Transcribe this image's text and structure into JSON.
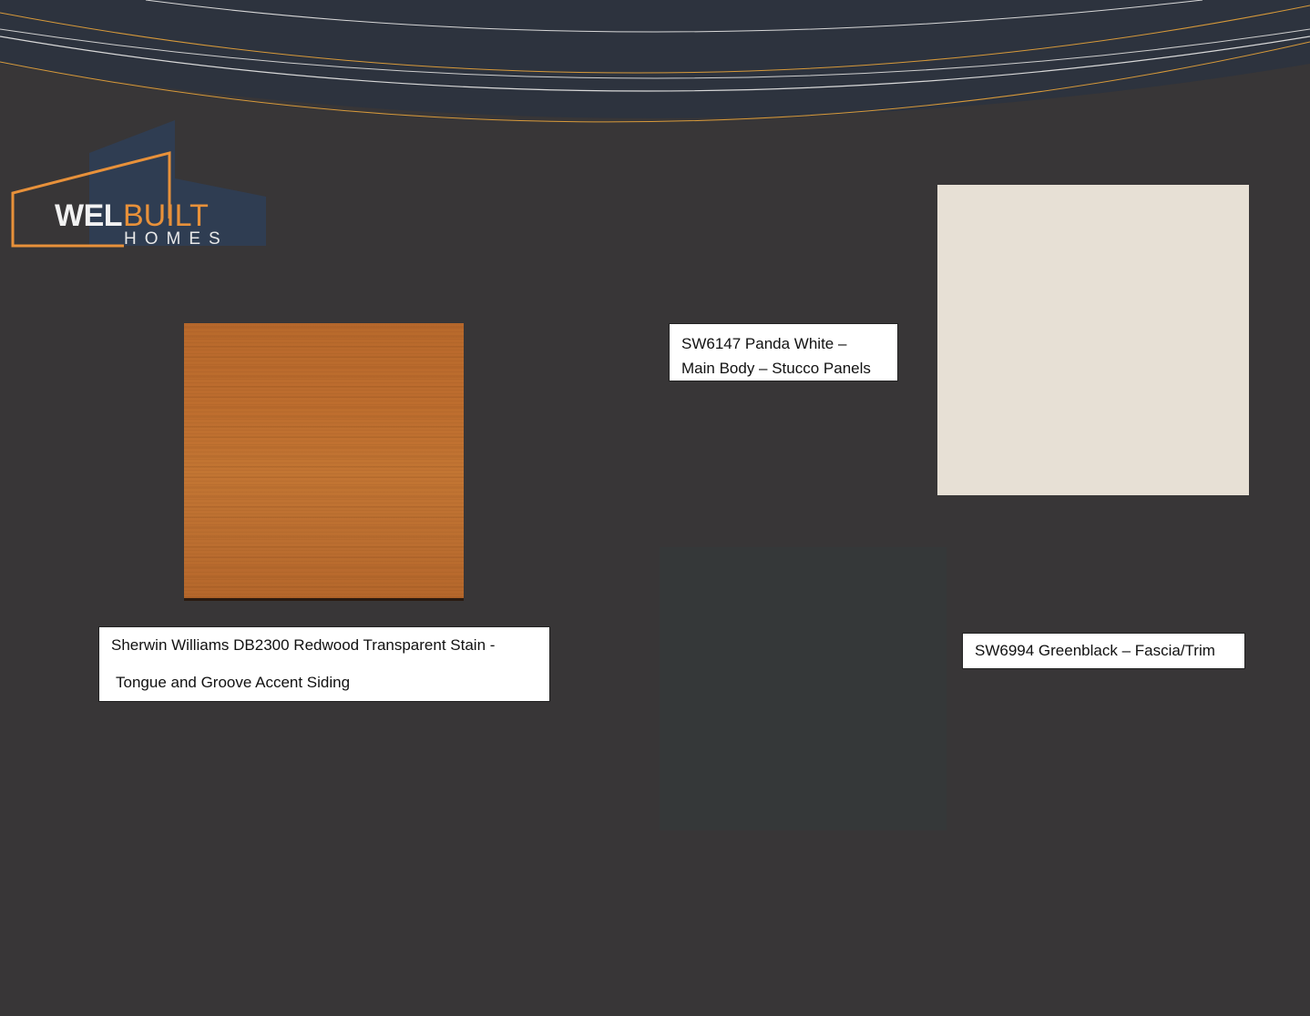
{
  "logo": {
    "wel": "WEL",
    "built": "BUILT",
    "homes": "HOMES"
  },
  "colors": {
    "background": "#383637",
    "header_band": "#2d333e",
    "accent_orange": "#e8913a",
    "logo_blue": "#2f3e55",
    "redwood": "#bd6d2e",
    "panda_white": "#e7e0d5",
    "greenblack": "#353839"
  },
  "swatches": {
    "redwood": {
      "label_line1": "Sherwin Williams DB2300 Redwood Transparent Stain -",
      "label_line2": "Tongue and Groove Accent Siding"
    },
    "panda_white": {
      "label_line1": "SW6147 Panda White –",
      "label_line2": "Main Body – Stucco Panels"
    },
    "greenblack": {
      "label": "SW6994 Greenblack – Fascia/Trim"
    }
  }
}
